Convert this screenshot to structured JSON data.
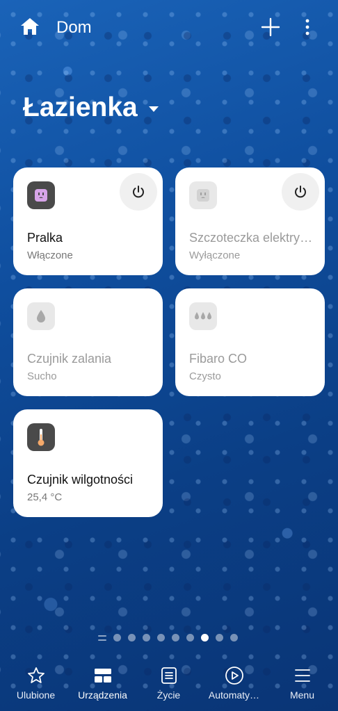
{
  "topbar": {
    "home_title": "Dom"
  },
  "room": {
    "name": "Łazienka"
  },
  "devices": [
    {
      "name": "Pralka",
      "status": "Włączone",
      "icon": "outlet-icon",
      "has_power": true,
      "on": true
    },
    {
      "name": "Szczoteczka elektryczna",
      "status": "Wyłączone",
      "icon": "outlet-icon",
      "has_power": true,
      "on": false
    },
    {
      "name": "Czujnik zalania",
      "status": "Sucho",
      "icon": "water-drop-icon",
      "has_power": false,
      "on": false
    },
    {
      "name": "Fibaro CO",
      "status": "Czysto",
      "icon": "triple-drop-icon",
      "has_power": false,
      "on": false
    },
    {
      "name": "Czujnik wilgotności",
      "status": "25,4 °C",
      "icon": "thermometer-icon",
      "has_power": false,
      "on": true
    }
  ],
  "pager": {
    "page_count": 8,
    "active_index": 6
  },
  "bottom_nav": {
    "items": [
      {
        "label": "Ulubione",
        "icon": "star-icon"
      },
      {
        "label": "Urządzenia",
        "icon": "devices-grid-icon",
        "active": true
      },
      {
        "label": "Życie",
        "icon": "life-icon"
      },
      {
        "label": "Automaty…",
        "icon": "play-circle-icon"
      },
      {
        "label": "Menu",
        "icon": "hamburger-icon"
      }
    ]
  },
  "colors": {
    "accent_outlet": "#d6a4e8",
    "thermo": "#f5a96a",
    "card_bg": "#ffffff"
  }
}
